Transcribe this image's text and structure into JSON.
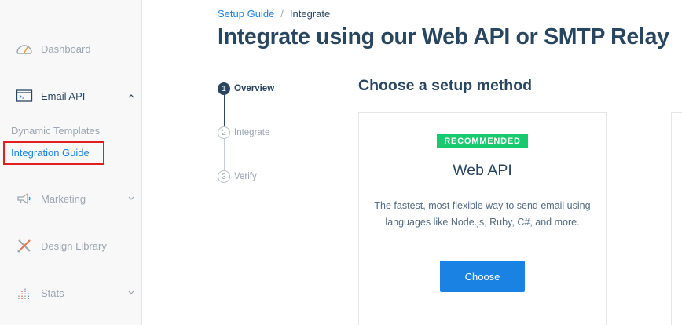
{
  "sidebar": {
    "items": [
      {
        "label": "Dashboard",
        "icon": "gauge-icon"
      },
      {
        "label": "Email API",
        "icon": "terminal-icon",
        "expanded": true
      },
      {
        "label": "Marketing",
        "icon": "megaphone-icon"
      },
      {
        "label": "Design Library",
        "icon": "design-tools-icon"
      },
      {
        "label": "Stats",
        "icon": "bar-chart-icon"
      }
    ],
    "email_api_subitems": [
      {
        "label": "Dynamic Templates"
      },
      {
        "label": "Integration Guide",
        "active": true
      }
    ]
  },
  "breadcrumb": {
    "parent": "Setup Guide",
    "separator": "/",
    "current": "Integrate"
  },
  "page_title": "Integrate using our Web API or SMTP Relay",
  "steps": [
    {
      "number": "1",
      "label": "Overview",
      "active": true
    },
    {
      "number": "2",
      "label": "Integrate",
      "active": false
    },
    {
      "number": "3",
      "label": "Verify",
      "active": false
    }
  ],
  "setup": {
    "heading": "Choose a setup method",
    "card": {
      "badge": "RECOMMENDED",
      "title": "Web API",
      "description": "The fastest, most flexible way to send email using languages like Node.js, Ruby, C#, and more.",
      "button": "Choose"
    }
  },
  "colors": {
    "primary": "#1a82e2",
    "navy": "#294661",
    "badge_green": "#18c96e",
    "highlight_red": "#e02020"
  }
}
